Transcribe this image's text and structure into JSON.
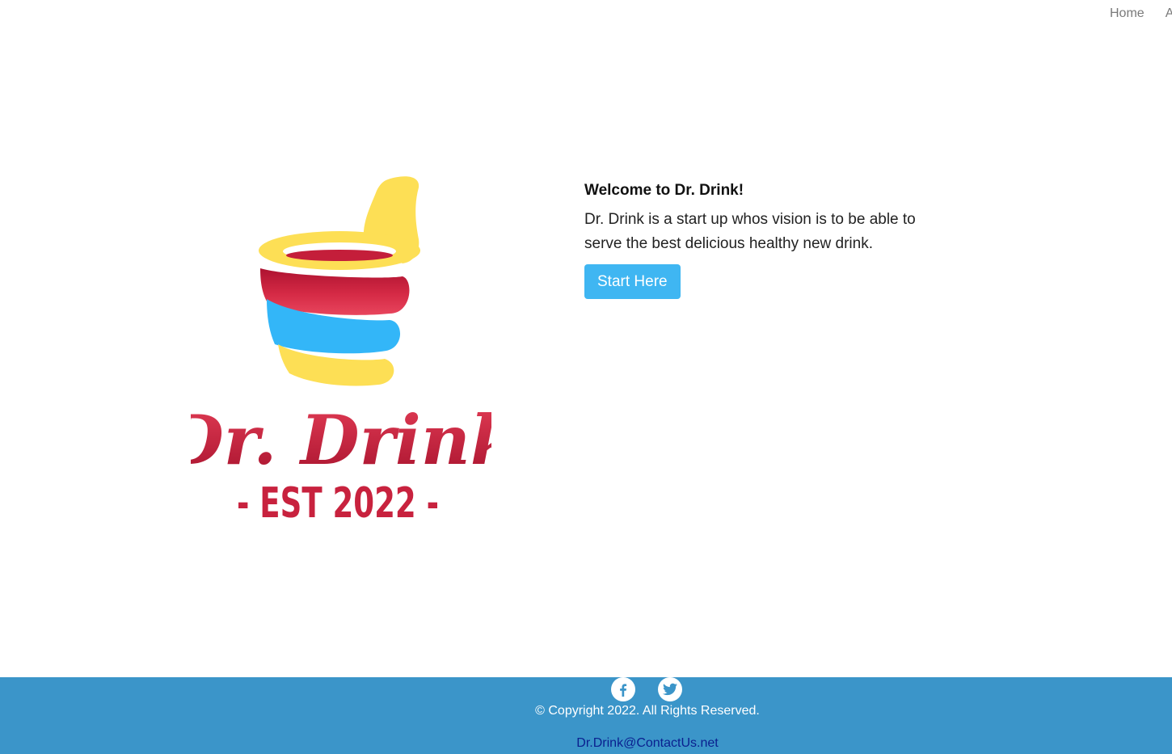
{
  "nav": {
    "items": [
      {
        "label": "Home"
      },
      {
        "label": "Ab"
      }
    ]
  },
  "logo": {
    "wordmark": "Dr. Drink",
    "established": "- EST 2022 -",
    "colors": {
      "yellow": "#fddf55",
      "red": "#c41e3a",
      "blue": "#33b6f8"
    }
  },
  "hero": {
    "title": "Welcome to Dr. Drink!",
    "body": "Dr. Drink is a start up whos vision is to be able to serve the best delicious healthy new drink.",
    "button_label": "Start Here"
  },
  "footer": {
    "socials": [
      {
        "icon": "facebook-icon"
      },
      {
        "icon": "twitter-icon"
      }
    ],
    "copyright": "© Copyright 2022. All Rights Reserved.",
    "email": "Dr.Drink@ContactUs.net",
    "background": "#3b95c9"
  }
}
